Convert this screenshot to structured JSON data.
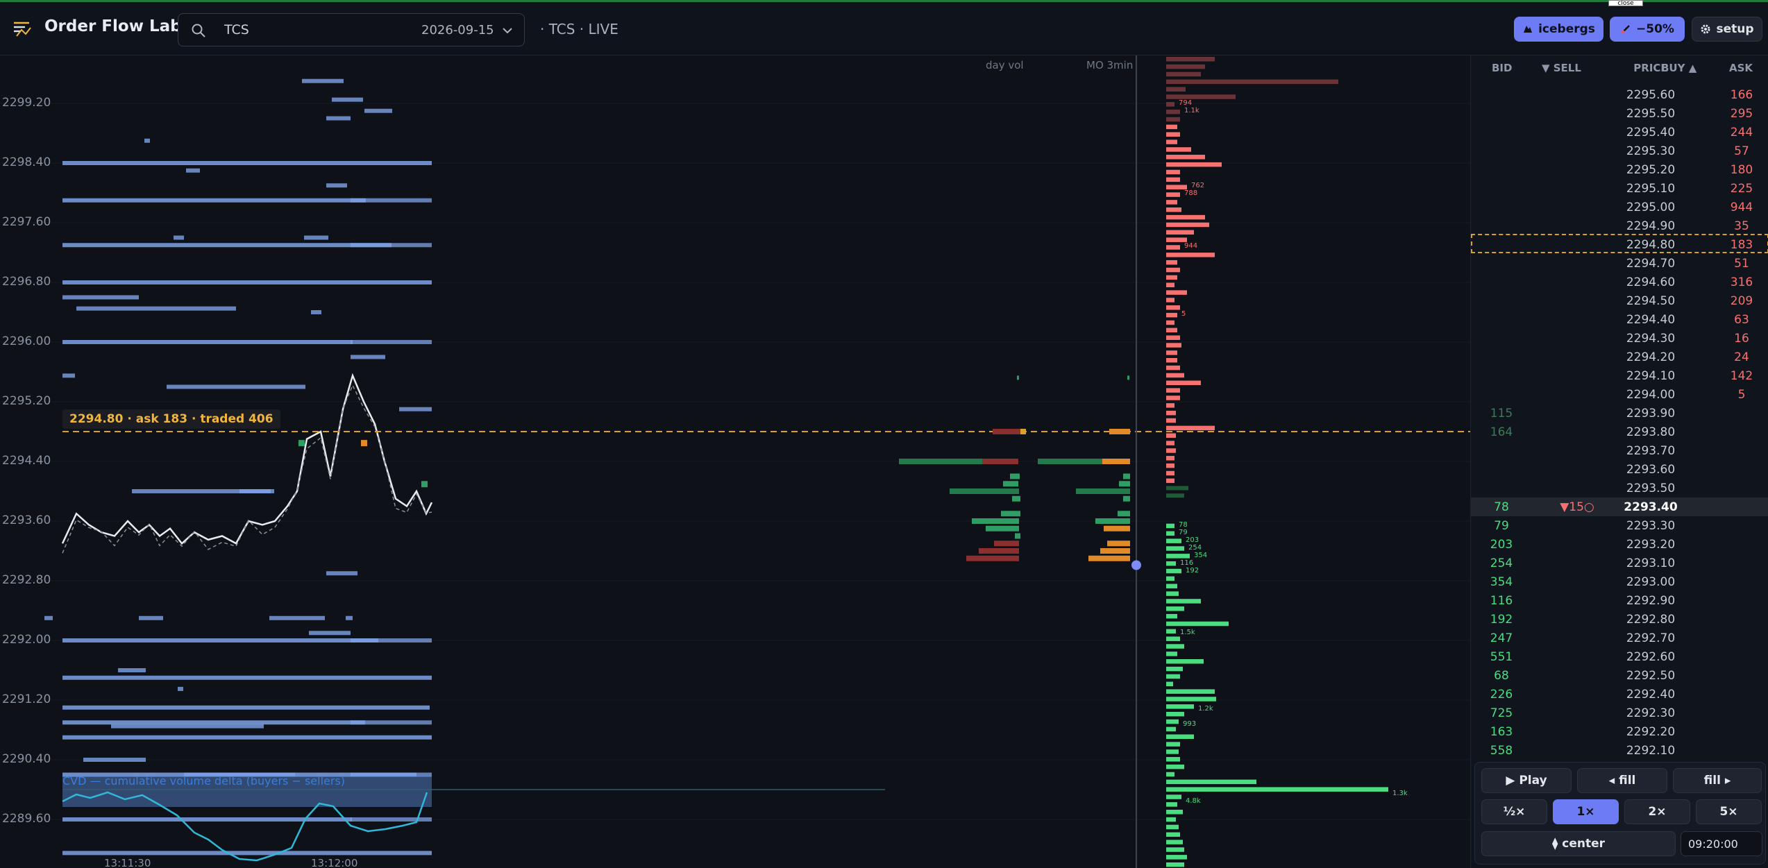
{
  "header": {
    "title": "Order Flow Lab",
    "search_value": "TCS",
    "date": "2026-09-15",
    "status": "· TCS · LIVE",
    "close_tooltip": "close"
  },
  "toolbar": {
    "icebergs_label": "icebergs",
    "zoom_label": "−50%",
    "setup_label": "setup"
  },
  "chart": {
    "price_axis": [
      "2299.20",
      "2298.40",
      "2297.60",
      "2296.80",
      "2296.00",
      "2295.20",
      "2294.40",
      "2293.60",
      "2292.80",
      "2292.00",
      "2291.20",
      "2290.40",
      "2289.60"
    ],
    "hover_label": "2294.80 · ask 183 · traded 406",
    "cvd_label": "CVD — cumulative volume delta (buyers − sellers)",
    "time_labels": [
      "13:11:30",
      "13:12:00"
    ],
    "column_labels": [
      "day vol",
      "MO 3min"
    ],
    "ladder_annotations": {
      "ask": [
        {
          "text": "794",
          "row": 6
        },
        {
          "text": "1.1k",
          "row": 7
        },
        {
          "text": "762",
          "row": 17
        },
        {
          "text": "788",
          "row": 18
        },
        {
          "text": "944",
          "row": 25
        },
        {
          "text": "5",
          "row": 34
        }
      ],
      "bid": [
        {
          "text": "78",
          "row": 36
        },
        {
          "text": "79",
          "row": 37
        },
        {
          "text": "203",
          "row": 38
        },
        {
          "text": "254",
          "row": 39
        },
        {
          "text": "354",
          "row": 40
        },
        {
          "text": "116",
          "row": 41
        },
        {
          "text": "192",
          "row": 42
        },
        {
          "text": "1.5k",
          "row": 50
        },
        {
          "text": "1.2k",
          "row": 60
        },
        {
          "text": "993",
          "row": 62
        },
        {
          "text": "1.3k",
          "row": 71
        },
        {
          "text": "4.8k",
          "row": 72
        },
        {
          "text": "1.3k",
          "row": 84
        }
      ]
    }
  },
  "dom": {
    "headers": {
      "bid": "BID",
      "sell": "▼ SELL",
      "price": "PRICE",
      "buy": "BUY ▲",
      "ask": "ASK"
    },
    "rows": [
      {
        "bid": "",
        "sell": "",
        "price": "2295.60",
        "ask": "166"
      },
      {
        "bid": "",
        "sell": "",
        "price": "2295.50",
        "ask": "295"
      },
      {
        "bid": "",
        "sell": "",
        "price": "2295.40",
        "ask": "244"
      },
      {
        "bid": "",
        "sell": "",
        "price": "2295.30",
        "ask": "57"
      },
      {
        "bid": "",
        "sell": "",
        "price": "2295.20",
        "ask": "180"
      },
      {
        "bid": "",
        "sell": "",
        "price": "2295.10",
        "ask": "225"
      },
      {
        "bid": "",
        "sell": "",
        "price": "2295.00",
        "ask": "944"
      },
      {
        "bid": "",
        "sell": "",
        "price": "2294.90",
        "ask": "35"
      },
      {
        "bid": "",
        "sell": "",
        "price": "2294.80",
        "ask": "183"
      },
      {
        "bid": "",
        "sell": "",
        "price": "2294.70",
        "ask": "51"
      },
      {
        "bid": "",
        "sell": "",
        "price": "2294.60",
        "ask": "316"
      },
      {
        "bid": "",
        "sell": "",
        "price": "2294.50",
        "ask": "209"
      },
      {
        "bid": "",
        "sell": "",
        "price": "2294.40",
        "ask": "63"
      },
      {
        "bid": "",
        "sell": "",
        "price": "2294.30",
        "ask": "16"
      },
      {
        "bid": "",
        "sell": "",
        "price": "2294.20",
        "ask": "24"
      },
      {
        "bid": "",
        "sell": "",
        "price": "2294.10",
        "ask": "142"
      },
      {
        "bid": "",
        "sell": "",
        "price": "2294.00",
        "ask": "5"
      },
      {
        "bid": "115",
        "sell": "",
        "price": "2293.90",
        "ask": ""
      },
      {
        "bid": "164",
        "sell": "",
        "price": "2293.80",
        "ask": ""
      },
      {
        "bid": "",
        "sell": "",
        "price": "2293.70",
        "ask": ""
      },
      {
        "bid": "",
        "sell": "",
        "price": "2293.60",
        "ask": ""
      },
      {
        "bid": "",
        "sell": "",
        "price": "2293.50",
        "ask": ""
      },
      {
        "bid": "78",
        "sell": "▼15○",
        "price": "2293.40",
        "ask": ""
      },
      {
        "bid": "79",
        "sell": "",
        "price": "2293.30",
        "ask": ""
      },
      {
        "bid": "203",
        "sell": "",
        "price": "2293.20",
        "ask": ""
      },
      {
        "bid": "254",
        "sell": "",
        "price": "2293.10",
        "ask": ""
      },
      {
        "bid": "354",
        "sell": "",
        "price": "2293.00",
        "ask": ""
      },
      {
        "bid": "116",
        "sell": "",
        "price": "2292.90",
        "ask": ""
      },
      {
        "bid": "192",
        "sell": "",
        "price": "2292.80",
        "ask": ""
      },
      {
        "bid": "247",
        "sell": "",
        "price": "2292.70",
        "ask": ""
      },
      {
        "bid": "551",
        "sell": "",
        "price": "2292.60",
        "ask": ""
      },
      {
        "bid": "68",
        "sell": "",
        "price": "2292.50",
        "ask": ""
      },
      {
        "bid": "226",
        "sell": "",
        "price": "2292.40",
        "ask": ""
      },
      {
        "bid": "725",
        "sell": "",
        "price": "2292.30",
        "ask": ""
      },
      {
        "bid": "163",
        "sell": "",
        "price": "2292.20",
        "ask": ""
      },
      {
        "bid": "558",
        "sell": "",
        "price": "2292.10",
        "ask": ""
      }
    ],
    "highlight_price": "2294.80",
    "last_price": "2293.40"
  },
  "controls": {
    "play": "▶ Play",
    "back_fill": "◂ fill",
    "fwd_fill": "fill ▸",
    "speeds": [
      "½×",
      "1×",
      "2×",
      "5×"
    ],
    "active_speed": "1×",
    "center": "⧫ center",
    "time": "09:20:00"
  },
  "colors": {
    "bid": "#4ade80",
    "ask": "#f87171",
    "accent": "#6d7cf5",
    "highlight": "#f0b53a",
    "resting": "#7ea2e6"
  }
}
